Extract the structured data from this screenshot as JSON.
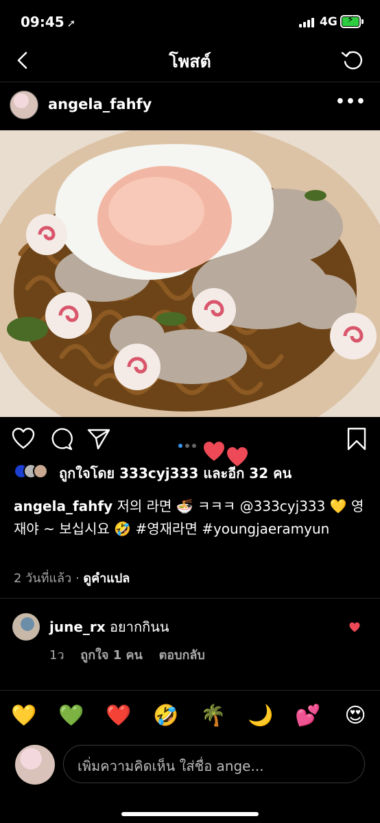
{
  "status_bar": {
    "time": "09:45",
    "network": "4G"
  },
  "nav": {
    "title": "โพสต์"
  },
  "post": {
    "username": "angela_fahfy",
    "carousel": {
      "count": 3,
      "active": 1
    },
    "likes_text": "ถูกใจโดย 333cyj333 และอีก 32 คน",
    "caption": {
      "user": "angela_fahfy",
      "text": "저의 라면 🍜 ㅋㅋㅋ @333cyj333 💛 영재야 ~ 보십시요 🤣 #영재라면 #youngjaeramyun"
    },
    "time_ago": "2 วันที่แล้ว",
    "separator": "·",
    "translate_label": "ดูคำแปล"
  },
  "comment": {
    "username": "june_rx",
    "text": "อยากกินน",
    "time": "1ว",
    "likes": "ถูกใจ 1 คน",
    "reply_label": "ตอบกลับ"
  },
  "reactions": [
    "💛",
    "💚",
    "❤️",
    "🤣",
    "🌴",
    "🌙",
    "💕",
    "😍"
  ],
  "composer": {
    "placeholder": "เพิ่มความคิดเห็น ใส่ชื่อ ange..."
  },
  "colors": {
    "background": "#000000",
    "like_red": "#ed4956",
    "dot_active": "#3897f0",
    "muted_text": "#a8a8a8"
  },
  "icons": [
    "back-icon",
    "refresh-icon",
    "more-icon",
    "heart-icon",
    "comment-icon",
    "share-icon",
    "bookmark-icon"
  ]
}
